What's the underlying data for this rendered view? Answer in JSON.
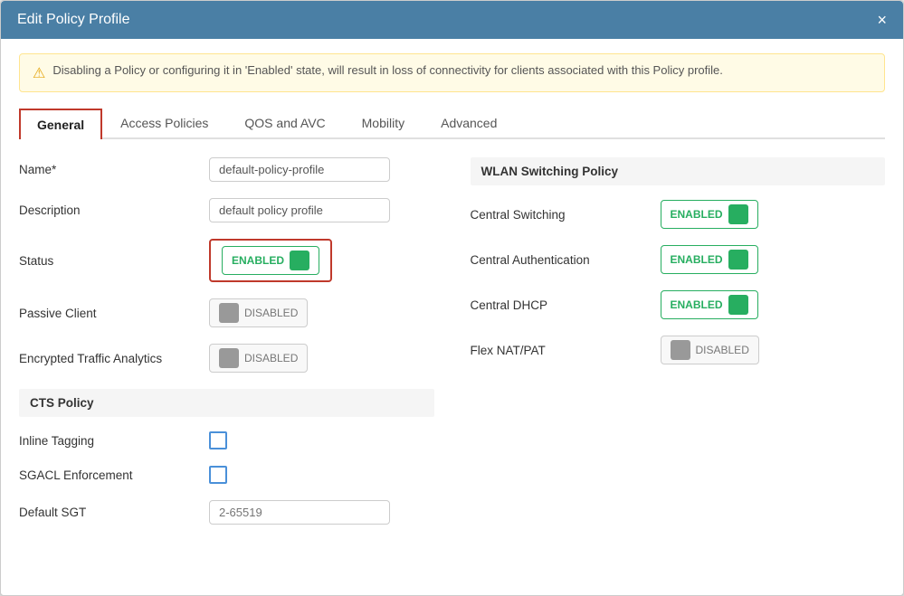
{
  "modal": {
    "title": "Edit Policy Profile",
    "close_label": "×"
  },
  "warning": {
    "text": "Disabling a Policy or configuring it in 'Enabled' state, will result in loss of connectivity for clients associated with this Policy profile."
  },
  "tabs": [
    {
      "id": "general",
      "label": "General",
      "active": true
    },
    {
      "id": "access-policies",
      "label": "Access Policies",
      "active": false
    },
    {
      "id": "qos-avc",
      "label": "QOS and AVC",
      "active": false
    },
    {
      "id": "mobility",
      "label": "Mobility",
      "active": false
    },
    {
      "id": "advanced",
      "label": "Advanced",
      "active": false
    }
  ],
  "left_panel": {
    "name_label": "Name*",
    "name_value": "default-policy-profile",
    "description_label": "Description",
    "description_value": "default policy profile",
    "status_label": "Status",
    "status_toggle_label": "ENABLED",
    "passive_client_label": "Passive Client",
    "passive_client_toggle_label": "DISABLED",
    "encrypted_traffic_label": "Encrypted Traffic Analytics",
    "encrypted_traffic_toggle_label": "DISABLED",
    "cts_section_header": "CTS Policy",
    "inline_tagging_label": "Inline Tagging",
    "sgacl_enforcement_label": "SGACL Enforcement",
    "default_sgt_label": "Default SGT",
    "default_sgt_placeholder": "2-65519"
  },
  "right_panel": {
    "wlan_section_header": "WLAN Switching Policy",
    "central_switching_label": "Central Switching",
    "central_switching_status": "ENABLED",
    "central_authentication_label": "Central Authentication",
    "central_authentication_status": "ENABLED",
    "central_dhcp_label": "Central DHCP",
    "central_dhcp_status": "ENABLED",
    "flex_nat_pat_label": "Flex NAT/PAT",
    "flex_nat_pat_status": "DISABLED"
  }
}
